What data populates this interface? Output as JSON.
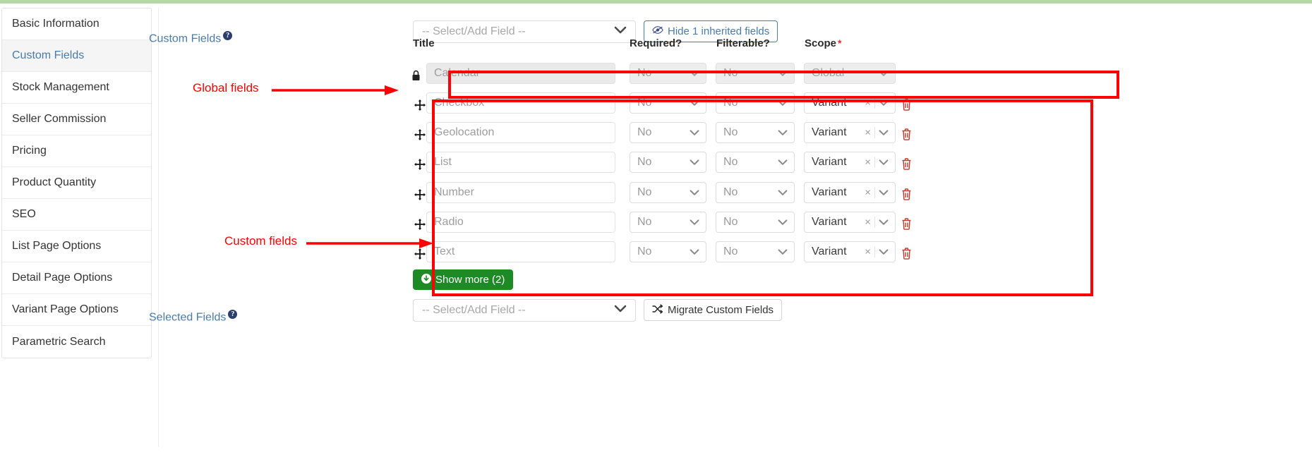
{
  "sidebar": {
    "items": [
      {
        "label": "Basic Information",
        "active": false
      },
      {
        "label": "Custom Fields",
        "active": true
      },
      {
        "label": "Stock Management",
        "active": false
      },
      {
        "label": "Seller Commission",
        "active": false
      },
      {
        "label": "Pricing",
        "active": false
      },
      {
        "label": "Product Quantity",
        "active": false
      },
      {
        "label": "SEO",
        "active": false
      },
      {
        "label": "List Page Options",
        "active": false
      },
      {
        "label": "Detail Page Options",
        "active": false
      },
      {
        "label": "Variant Page Options",
        "active": false
      },
      {
        "label": "Parametric Search",
        "active": false
      }
    ]
  },
  "custom_fields_section": {
    "label": "Custom Fields",
    "help_glyph": "?",
    "select_add": {
      "value": "-- Select/Add Field --",
      "placeholder": "-- Select/Add Field --"
    },
    "hide_inherited_button": {
      "label": "Hide 1 inherited fields",
      "icon": "eye-slash-icon"
    },
    "columns": {
      "title": "Title",
      "required": "Required?",
      "filterable": "Filterable?",
      "scope": "Scope",
      "scope_required_marker": "*"
    },
    "global_rows": [
      {
        "title": "Calendar",
        "icon": "lock-icon",
        "required": "No",
        "filterable": "No",
        "scope": "Global",
        "locked": true
      }
    ],
    "custom_rows": [
      {
        "title": "Checkbox",
        "icon": "drag-handle-icon",
        "required": "No",
        "filterable": "No",
        "scope": "Variant",
        "clear": "×",
        "delete_icon": "trash-icon"
      },
      {
        "title": "Geolocation",
        "icon": "drag-handle-icon",
        "required": "No",
        "filterable": "No",
        "scope": "Variant",
        "clear": "×",
        "delete_icon": "trash-icon"
      },
      {
        "title": "List",
        "icon": "drag-handle-icon",
        "required": "No",
        "filterable": "No",
        "scope": "Variant",
        "clear": "×",
        "delete_icon": "trash-icon"
      },
      {
        "title": "Number",
        "icon": "drag-handle-icon",
        "required": "No",
        "filterable": "No",
        "scope": "Variant",
        "clear": "×",
        "delete_icon": "trash-icon"
      },
      {
        "title": "Radio",
        "icon": "drag-handle-icon",
        "required": "No",
        "filterable": "No",
        "scope": "Variant",
        "clear": "×",
        "delete_icon": "trash-icon"
      },
      {
        "title": "Text",
        "icon": "drag-handle-icon",
        "required": "No",
        "filterable": "No",
        "scope": "Variant",
        "clear": "×",
        "delete_icon": "trash-icon"
      }
    ],
    "show_more_button": {
      "label": "Show more (2)",
      "icon": "arrow-down-circle-icon"
    }
  },
  "selected_fields_section": {
    "label": "Selected Fields",
    "help_glyph": "?",
    "select_add": {
      "value": "-- Select/Add Field --",
      "placeholder": "-- Select/Add Field --"
    },
    "migrate_button": {
      "label": "Migrate Custom Fields",
      "icon": "shuffle-icon"
    }
  },
  "annotations": [
    {
      "text": "Global fields",
      "color": "#ff0000"
    },
    {
      "text": "Custom fields",
      "color": "#ff0000"
    }
  ],
  "colors": {
    "annotation_red": "#ff0000",
    "link_blue": "#4a7ba7",
    "green_button": "#1e8a26",
    "trash_red": "#c0392b",
    "top_bar_green": "#b6d7a8"
  }
}
